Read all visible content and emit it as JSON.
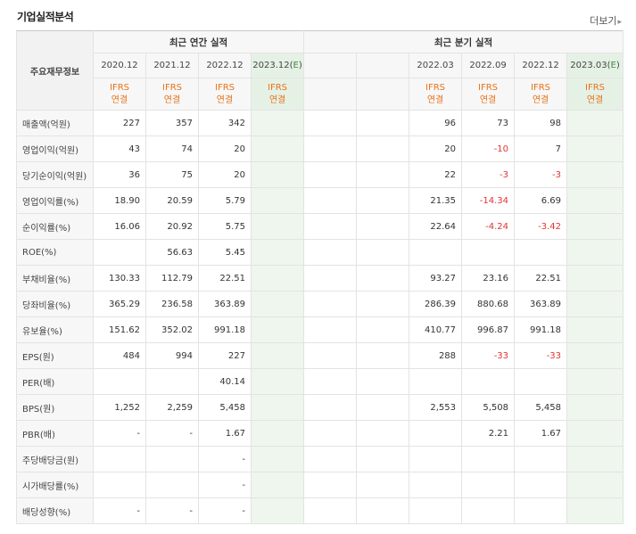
{
  "title": "기업실적분석",
  "more_label": "더보기",
  "header": {
    "row_label": "주요재무정보",
    "annual_title": "최근 연간 실적",
    "quarter_title": "최근 분기 실적",
    "annual_periods": [
      "2020.12",
      "2021.12",
      "2022.12",
      "2023.12(E)"
    ],
    "quarter_periods": [
      "",
      "",
      "2022.03",
      "2022.09",
      "2022.12",
      "2023.03(E)"
    ],
    "ifrs": "IFRS",
    "consolidated": "연결"
  },
  "rows": [
    {
      "label": "매출액(억원)",
      "annual": [
        "227",
        "357",
        "342",
        ""
      ],
      "quarter": [
        "",
        "",
        "96",
        "73",
        "98",
        ""
      ]
    },
    {
      "label": "영업이익(억원)",
      "annual": [
        "43",
        "74",
        "20",
        ""
      ],
      "quarter": [
        "",
        "",
        "20",
        "-10",
        "7",
        ""
      ]
    },
    {
      "label": "당기순이익(억원)",
      "annual": [
        "36",
        "75",
        "20",
        ""
      ],
      "quarter": [
        "",
        "",
        "22",
        "-3",
        "-3",
        ""
      ]
    },
    {
      "label": "영업이익률(%)",
      "annual": [
        "18.90",
        "20.59",
        "5.79",
        ""
      ],
      "quarter": [
        "",
        "",
        "21.35",
        "-14.34",
        "6.69",
        ""
      ]
    },
    {
      "label": "순이익률(%)",
      "annual": [
        "16.06",
        "20.92",
        "5.75",
        ""
      ],
      "quarter": [
        "",
        "",
        "22.64",
        "-4.24",
        "-3.42",
        ""
      ]
    },
    {
      "label": "ROE(%)",
      "annual": [
        "",
        "56.63",
        "5.45",
        ""
      ],
      "quarter": [
        "",
        "",
        "",
        "",
        "",
        ""
      ]
    },
    {
      "label": "부채비율(%)",
      "annual": [
        "130.33",
        "112.79",
        "22.51",
        ""
      ],
      "quarter": [
        "",
        "",
        "93.27",
        "23.16",
        "22.51",
        ""
      ]
    },
    {
      "label": "당좌비율(%)",
      "annual": [
        "365.29",
        "236.58",
        "363.89",
        ""
      ],
      "quarter": [
        "",
        "",
        "286.39",
        "880.68",
        "363.89",
        ""
      ]
    },
    {
      "label": "유보율(%)",
      "annual": [
        "151.62",
        "352.02",
        "991.18",
        ""
      ],
      "quarter": [
        "",
        "",
        "410.77",
        "996.87",
        "991.18",
        ""
      ]
    },
    {
      "label": "EPS(원)",
      "annual": [
        "484",
        "994",
        "227",
        ""
      ],
      "quarter": [
        "",
        "",
        "288",
        "-33",
        "-33",
        ""
      ]
    },
    {
      "label": "PER(배)",
      "annual": [
        "",
        "",
        "40.14",
        ""
      ],
      "quarter": [
        "",
        "",
        "",
        "",
        "",
        ""
      ]
    },
    {
      "label": "BPS(원)",
      "annual": [
        "1,252",
        "2,259",
        "5,458",
        ""
      ],
      "quarter": [
        "",
        "",
        "2,553",
        "5,508",
        "5,458",
        ""
      ]
    },
    {
      "label": "PBR(배)",
      "annual": [
        "-",
        "-",
        "1.67",
        ""
      ],
      "quarter": [
        "",
        "",
        "",
        "2.21",
        "1.67",
        ""
      ]
    },
    {
      "label": "주당배당금(원)",
      "annual": [
        "",
        "",
        "-",
        ""
      ],
      "quarter": [
        "",
        "",
        "",
        "",
        "",
        ""
      ]
    },
    {
      "label": "시가배당률(%)",
      "annual": [
        "",
        "",
        "-",
        ""
      ],
      "quarter": [
        "",
        "",
        "",
        "",
        "",
        ""
      ]
    },
    {
      "label": "배당성향(%)",
      "annual": [
        "-",
        "-",
        "-",
        ""
      ],
      "quarter": [
        "",
        "",
        "",
        "",
        "",
        ""
      ]
    }
  ],
  "colors": {
    "ifrs": "#e8731b",
    "negative": "#e03333",
    "estimate_bg": "#eef6ee"
  }
}
